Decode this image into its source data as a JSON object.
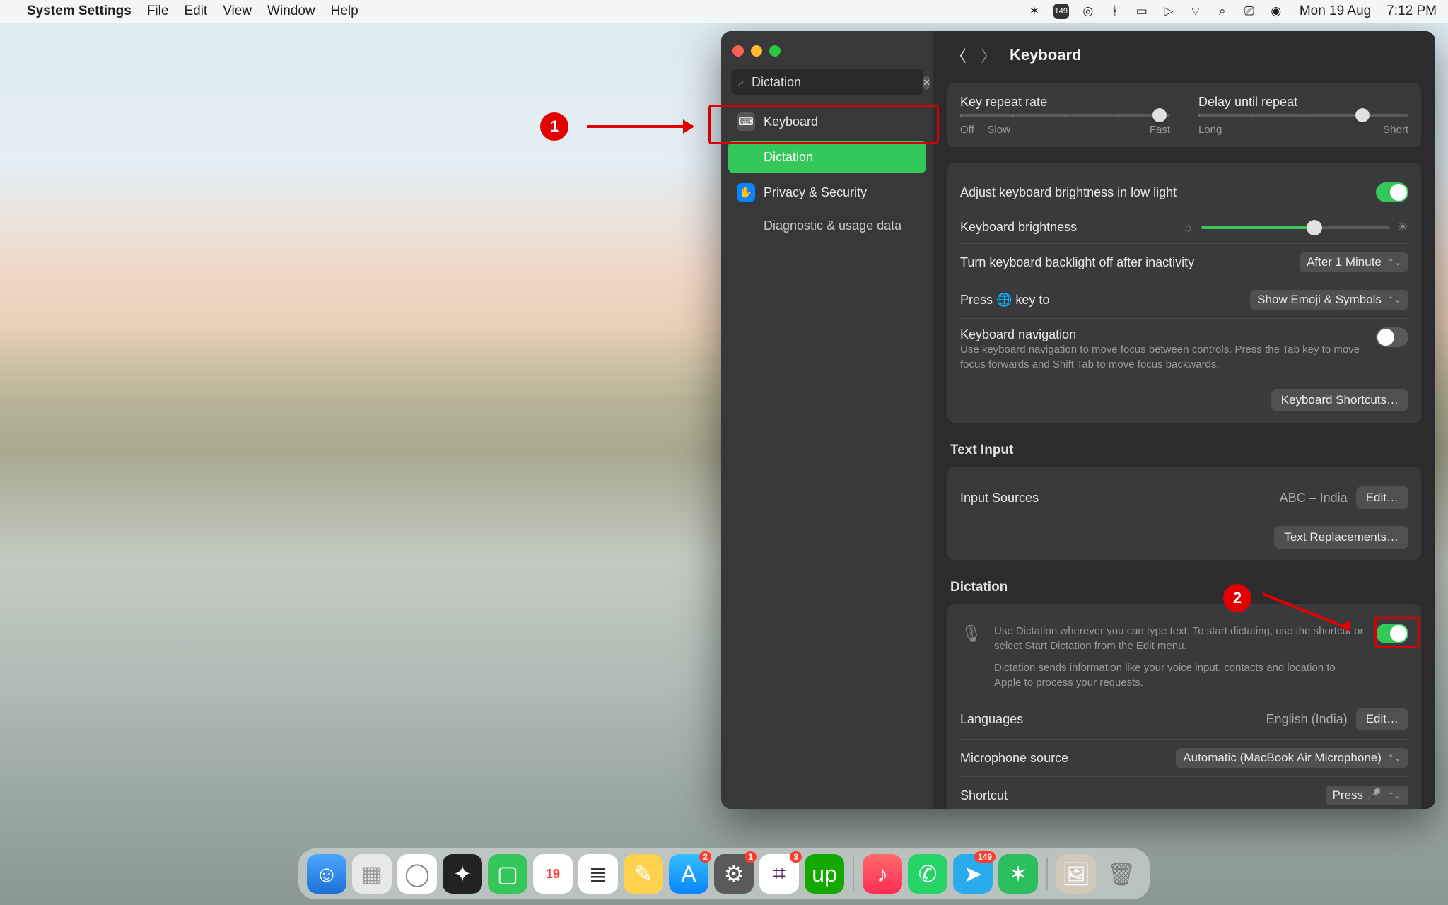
{
  "menubar": {
    "app_name": "System Settings",
    "items": [
      "File",
      "Edit",
      "View",
      "Window",
      "Help"
    ],
    "date": "Mon 19 Aug",
    "time": "7:12 PM",
    "badge_149": "149"
  },
  "window": {
    "search_value": "Dictation",
    "sidebar": {
      "items": [
        {
          "label": "Keyboard",
          "icon": "keyboard-icon"
        },
        {
          "label": "Dictation",
          "icon": "",
          "active": true
        },
        {
          "label": "Privacy & Security",
          "icon": "hand-icon"
        },
        {
          "label": "Diagnostic & usage data",
          "sub": true
        }
      ]
    },
    "title": "Keyboard",
    "key_repeat": {
      "label": "Key repeat rate",
      "left": "Off",
      "mid": "Slow",
      "right": "Fast",
      "pos": 95
    },
    "delay_repeat": {
      "label": "Delay until repeat",
      "left": "Long",
      "right": "Short",
      "pos": 78
    },
    "brightness_auto": {
      "label": "Adjust keyboard brightness in low light",
      "on": true
    },
    "brightness": {
      "label": "Keyboard brightness",
      "pos": 60
    },
    "backlight_off": {
      "label": "Turn keyboard backlight off after inactivity",
      "value": "After 1 Minute"
    },
    "globe_key": {
      "label": "Press 🌐 key to",
      "value": "Show Emoji & Symbols"
    },
    "kb_nav": {
      "label": "Keyboard navigation",
      "desc": "Use keyboard navigation to move focus between controls. Press the Tab key to move focus forwards and Shift Tab to move focus backwards.",
      "on": false
    },
    "shortcuts_btn": "Keyboard Shortcuts…",
    "text_input_header": "Text Input",
    "input_sources": {
      "label": "Input Sources",
      "value": "ABC – India",
      "btn": "Edit…"
    },
    "text_replacements_btn": "Text Replacements…",
    "dictation_header": "Dictation",
    "dictation_toggle": {
      "desc1": "Use Dictation wherever you can type text. To start dictating, use the shortcut or select Start Dictation from the Edit menu.",
      "desc2": "Dictation sends information like your voice input, contacts and location to Apple to process your requests.",
      "on": true
    },
    "languages": {
      "label": "Languages",
      "value": "English (India)",
      "btn": "Edit…"
    },
    "mic_source": {
      "label": "Microphone source",
      "value": "Automatic (MacBook Air Microphone)"
    },
    "shortcut": {
      "label": "Shortcut",
      "value": "Press 🎤"
    }
  },
  "dock": {
    "items": [
      "finder",
      "launchpad",
      "chrome",
      "fcp",
      "facetime",
      "calendar",
      "reminders",
      "notes",
      "appstore",
      "settings",
      "slack",
      "upwork"
    ],
    "items2": [
      "music",
      "whatsapp",
      "telegram",
      "evernote"
    ],
    "items3": [
      "preview",
      "trash"
    ],
    "cal_day": "19",
    "badges": {
      "appstore": "2",
      "settings": "1",
      "slack": "3",
      "telegram": "149"
    }
  },
  "annotations": {
    "one": "1",
    "two": "2"
  }
}
